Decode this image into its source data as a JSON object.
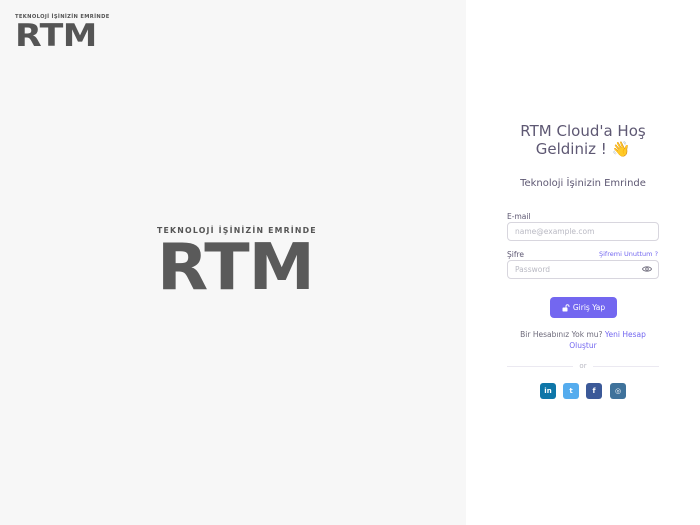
{
  "brand": {
    "tagline": "TEKNOLOJİ İŞİNİZİN EMRİNDE",
    "name": "RTM"
  },
  "login": {
    "title_line1": "RTM Cloud'a Hoş",
    "title_line2": "Geldiniz !",
    "title_emoji": "👋",
    "subtitle": "Teknoloji İşinizin Emrinde",
    "email_label": "E-mail",
    "email_placeholder": "name@example.com",
    "password_label": "Şifre",
    "password_placeholder": "Password",
    "forgot_label": "Şifremi Unuttum ?",
    "login_label": "Giriş Yap",
    "no_account_text": "Bir Hesabınız Yok mu?",
    "create_account_line1": "Yeni Hesap",
    "create_account_line2": "Oluştur",
    "or_text": "or"
  },
  "social": [
    {
      "name": "linkedin",
      "glyph": "in",
      "color": "#0e76a8"
    },
    {
      "name": "twitter",
      "glyph": "t",
      "color": "#55acee"
    },
    {
      "name": "facebook",
      "glyph": "f",
      "color": "#3b5998"
    },
    {
      "name": "instagram",
      "glyph": "◎",
      "color": "#3f729b"
    }
  ],
  "colors": {
    "primary": "#7367f0",
    "left_bg": "#f7f7f7",
    "text": "#5e5873"
  }
}
